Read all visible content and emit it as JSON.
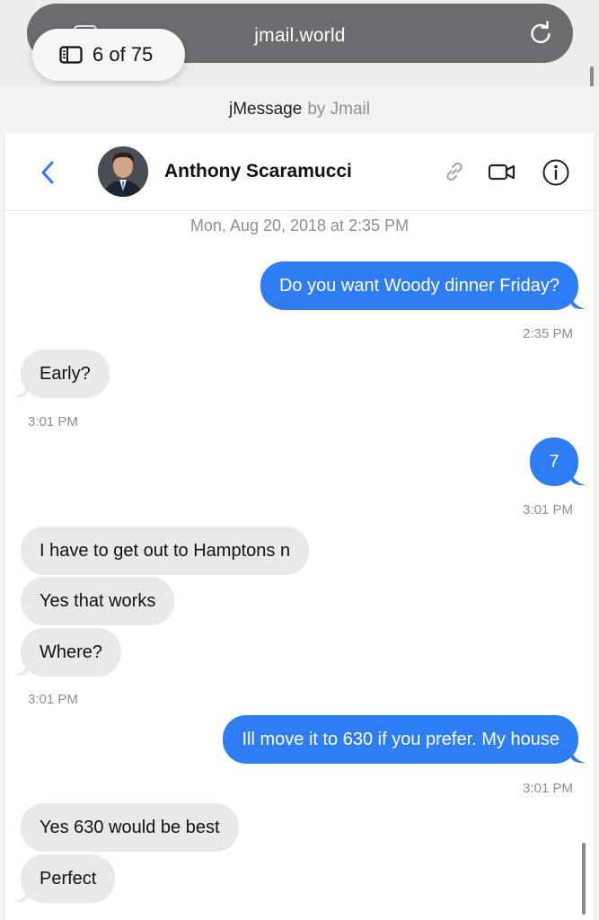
{
  "browser": {
    "url": "jmail.world",
    "tab_count_label": "6 of 75"
  },
  "app": {
    "brand": "jMessage",
    "by_label": "by Jmail"
  },
  "conversation": {
    "contact_name": "Anthony Scaramucci",
    "date_header": "Mon, Aug 20, 2018 at 2:35 PM",
    "messages": [
      {
        "direction": "outgoing",
        "text": "Do you want Woody dinner Friday?"
      },
      {
        "direction": "incoming",
        "text": "Early?"
      },
      {
        "direction": "outgoing",
        "text": "7"
      },
      {
        "direction": "incoming",
        "text": "I have to get out to Hamptons n"
      },
      {
        "direction": "incoming",
        "text": "Yes that works"
      },
      {
        "direction": "incoming",
        "text": "Where?"
      },
      {
        "direction": "outgoing",
        "text": "Ill move it to 630 if you prefer. My house"
      },
      {
        "direction": "incoming",
        "text": "Yes 630 would be best"
      },
      {
        "direction": "incoming",
        "text": "Perfect"
      }
    ],
    "timestamps": [
      "2:35 PM",
      "3:01 PM",
      "3:01 PM",
      "3:01 PM",
      "3:01 PM"
    ]
  },
  "icons": {
    "reload": "reload-icon",
    "tabs": "tabs-icon",
    "back": "chevron-left-icon",
    "link": "link-icon",
    "video": "video-camera-icon",
    "info": "info-icon"
  },
  "colors": {
    "outgoing_bubble": "#2f7df2",
    "incoming_bubble": "#e9e9eb",
    "accent": "#2f7df2"
  }
}
